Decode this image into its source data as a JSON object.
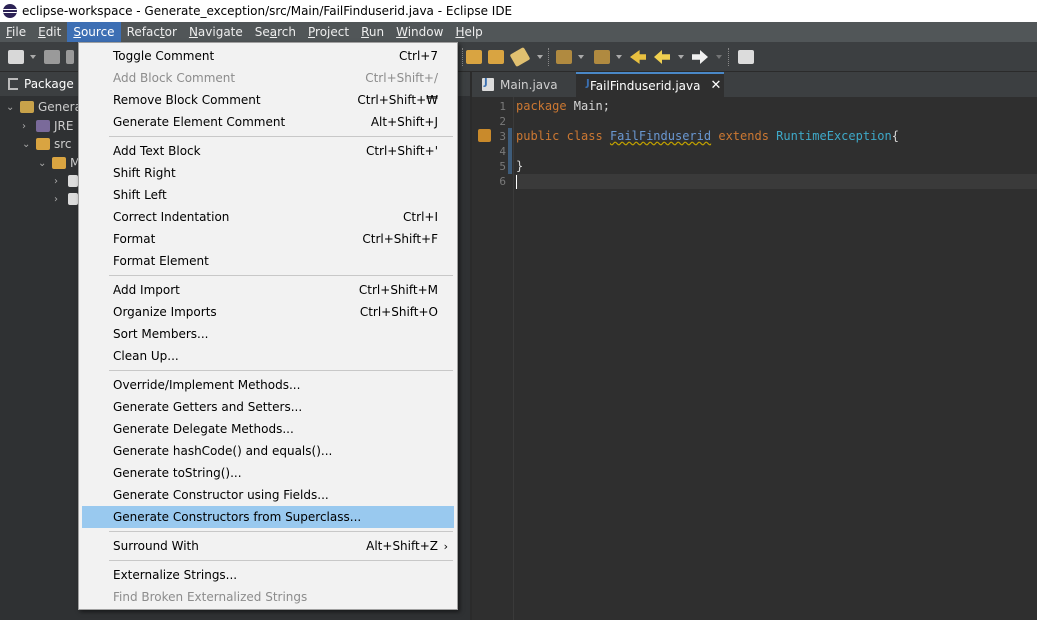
{
  "window": {
    "title": "eclipse-workspace - Generate_exception/src/Main/FailFinduserid.java - Eclipse IDE"
  },
  "menubar": {
    "items": [
      {
        "label": "File",
        "u": "F",
        "rest": "ile"
      },
      {
        "label": "Edit",
        "u": "E",
        "rest": "dit"
      },
      {
        "label": "Source",
        "u": "S",
        "rest": "ource"
      },
      {
        "label": "Refactor",
        "pre": "Refac",
        "u": "t",
        "rest": "or"
      },
      {
        "label": "Navigate",
        "u": "N",
        "rest": "avigate"
      },
      {
        "label": "Search",
        "pre": "Se",
        "u": "a",
        "rest": "rch"
      },
      {
        "label": "Project",
        "u": "P",
        "rest": "roject"
      },
      {
        "label": "Run",
        "u": "R",
        "rest": "un"
      },
      {
        "label": "Window",
        "u": "W",
        "rest": "indow"
      },
      {
        "label": "Help",
        "u": "H",
        "rest": "elp"
      }
    ]
  },
  "package_explorer": {
    "title": "Package Ex",
    "tree": [
      {
        "label": "Genera"
      },
      {
        "label": "JRE"
      },
      {
        "label": "src"
      },
      {
        "label": "M"
      }
    ]
  },
  "editor": {
    "tabs": [
      {
        "label": "Main.java"
      },
      {
        "label": "FailFinduserid.java",
        "close": "✕"
      }
    ],
    "line_numbers": [
      "1",
      "2",
      "3",
      "4",
      "5",
      "6"
    ],
    "code": {
      "l1_kw": "package",
      "l1_rest": " Main;",
      "l3_kw1": "public",
      "l3_kw2": "class",
      "l3_cls": "FailFinduserid",
      "l3_kw3": "extends",
      "l3_type": "RuntimeException",
      "l3_brace": "{",
      "l5_brace": "}"
    }
  },
  "source_menu": {
    "items": [
      {
        "label": "Toggle Comment",
        "shortcut": "Ctrl+7"
      },
      {
        "label": "Add Block Comment",
        "shortcut": "Ctrl+Shift+/",
        "disabled": true
      },
      {
        "label": "Remove Block Comment",
        "shortcut": "Ctrl+Shift+₩"
      },
      {
        "label": "Generate Element Comment",
        "shortcut": "Alt+Shift+J"
      },
      {
        "label": "Add Text Block",
        "shortcut": "Ctrl+Shift+'"
      },
      {
        "label": "Shift Right",
        "shortcut": ""
      },
      {
        "label": "Shift Left",
        "shortcut": ""
      },
      {
        "label": "Correct Indentation",
        "shortcut": "Ctrl+I"
      },
      {
        "label": "Format",
        "shortcut": "Ctrl+Shift+F"
      },
      {
        "label": "Format Element",
        "shortcut": ""
      },
      {
        "label": "Add Import",
        "shortcut": "Ctrl+Shift+M"
      },
      {
        "label": "Organize Imports",
        "shortcut": "Ctrl+Shift+O"
      },
      {
        "label": "Sort Members...",
        "shortcut": ""
      },
      {
        "label": "Clean Up...",
        "shortcut": ""
      },
      {
        "label": "Override/Implement Methods...",
        "shortcut": ""
      },
      {
        "label": "Generate Getters and Setters...",
        "shortcut": ""
      },
      {
        "label": "Generate Delegate Methods...",
        "shortcut": ""
      },
      {
        "label": "Generate hashCode() and equals()...",
        "shortcut": ""
      },
      {
        "label": "Generate toString()...",
        "shortcut": ""
      },
      {
        "label": "Generate Constructor using Fields...",
        "shortcut": ""
      },
      {
        "label": "Generate Constructors from Superclass...",
        "shortcut": "",
        "highlighted": true
      },
      {
        "label": "Surround With",
        "shortcut": "Alt+Shift+Z",
        "submenu_arrow": "›"
      },
      {
        "label": "Externalize Strings...",
        "shortcut": ""
      },
      {
        "label": "Find Broken Externalized Strings",
        "shortcut": "",
        "disabled": true
      }
    ]
  },
  "colors": {
    "menu_highlight": "#99c9ef",
    "active_menubar": "#3d6fb4",
    "keyword": "#cc7832",
    "type": "#3ea9c9"
  }
}
